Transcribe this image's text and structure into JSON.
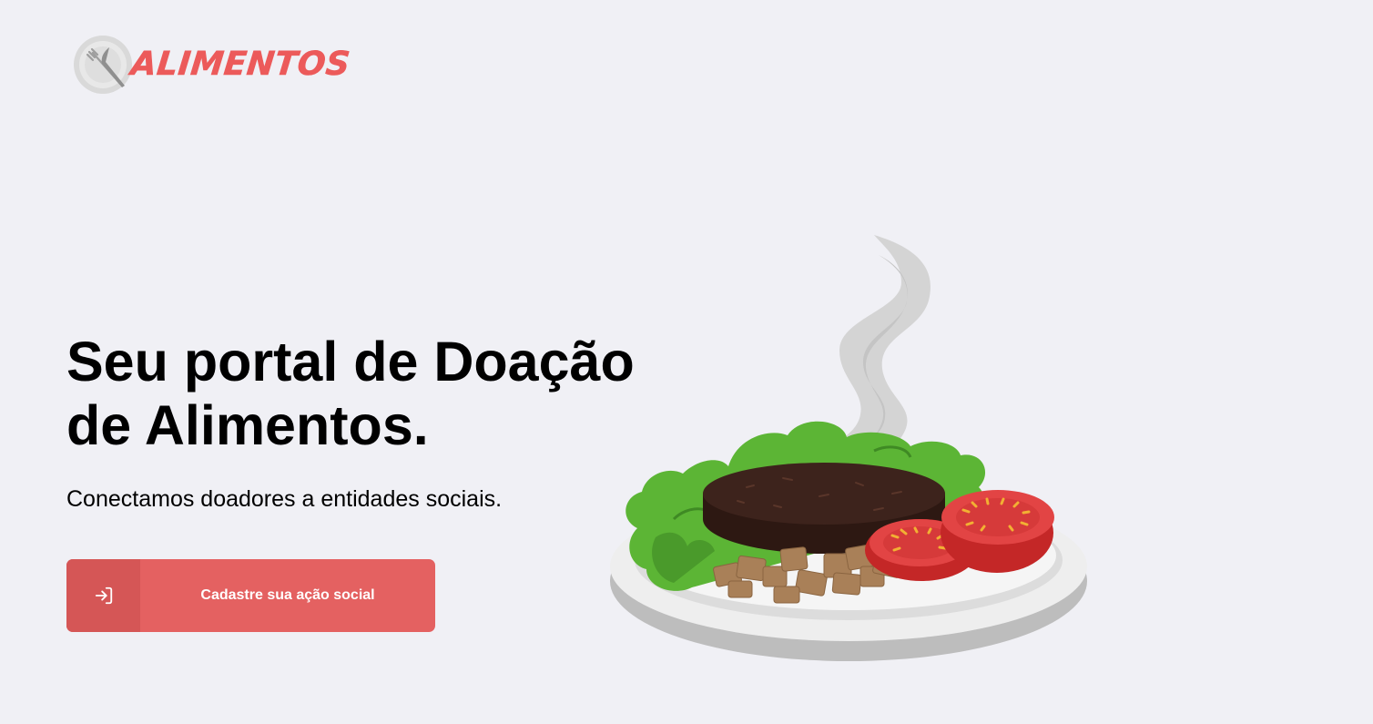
{
  "brand": {
    "name": "ALIMENTOS",
    "logo_icon": "plate-cutlery-icon",
    "color": "#ec5a5a"
  },
  "hero": {
    "title": "Seu portal de Doação de Alimentos.",
    "subtitle": "Conectamos doadores a entidades sociais."
  },
  "cta": {
    "label": "Cadastre sua ação social",
    "icon": "log-in-icon",
    "color": "#e46161",
    "icon_bg": "#d55656"
  },
  "illustration": {
    "name": "plate-with-burger-salad-tomato",
    "colors": {
      "plate": "#f2f2f2",
      "plate_shadow": "#bdbdbd",
      "lettuce": "#5cb535",
      "burger": "#3d231c",
      "tomato": "#d93030",
      "croutons": "#a98058",
      "steam": "#cfcfcf"
    }
  },
  "background": "#f0f0f5"
}
